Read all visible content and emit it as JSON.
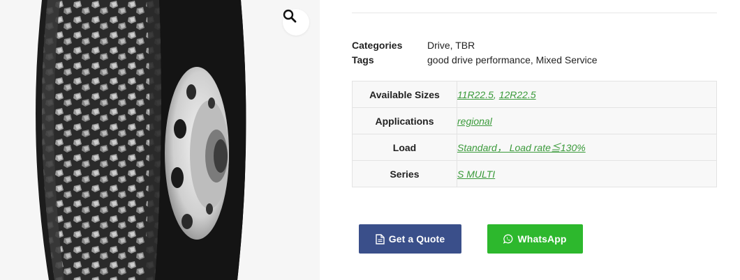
{
  "product": {
    "image_alt": "truck tire with drive tread",
    "zoom_icon": "magnifier-icon"
  },
  "meta": {
    "categories_label": "Categories",
    "categories": [
      {
        "label": "Drive"
      },
      {
        "label": "TBR"
      }
    ],
    "tags_label": "Tags",
    "tags": [
      {
        "label": "good drive performance"
      },
      {
        "label": "Mixed Service"
      }
    ]
  },
  "attributes": [
    {
      "label": "Available Sizes",
      "values": [
        "11R22.5",
        "12R22.5"
      ]
    },
    {
      "label": "Applications",
      "values": [
        "regional"
      ]
    },
    {
      "label": "Load",
      "values": [
        "Standard， Load rate≦130%"
      ]
    },
    {
      "label": "Series",
      "values": [
        "S MULTI"
      ]
    }
  ],
  "actions": {
    "quote_label": "Get a Quote",
    "quote_icon": "document-icon",
    "whatsapp_label": "WhatsApp",
    "whatsapp_icon": "whatsapp-icon"
  },
  "colors": {
    "quote_button": "#3a4f8a",
    "whatsapp_button": "#2db82d",
    "attribute_value": "#3a9a3a"
  }
}
